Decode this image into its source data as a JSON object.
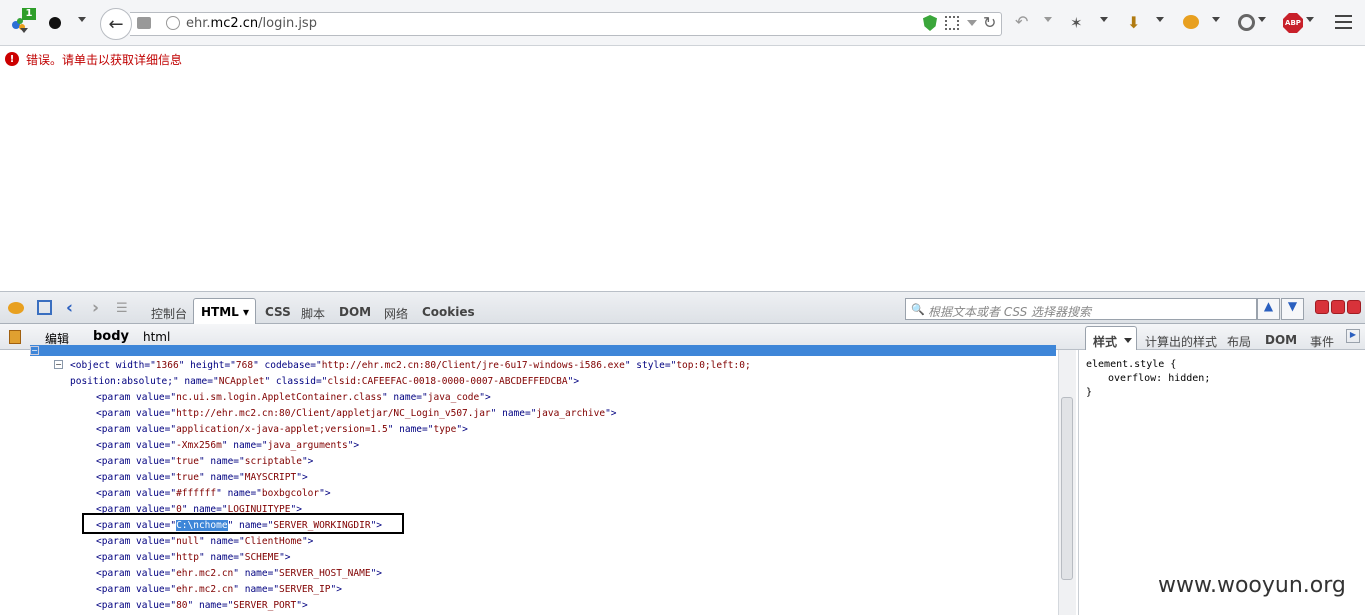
{
  "browser": {
    "url_prefix": "ehr.",
    "url_domain": "mc2.cn",
    "url_path": "/login.jsp",
    "badge_count": "1",
    "abp_label": "ABP"
  },
  "page": {
    "error_message": "错误。请单击以获取详细信息"
  },
  "firebug": {
    "tabs": [
      "控制台",
      "HTML",
      "CSS",
      "脚本",
      "DOM",
      "网络",
      "Cookies"
    ],
    "search_placeholder": "根据文本或者 CSS 选择器搜索",
    "edit_label": "编辑",
    "breadcrumb": [
      "body",
      "html"
    ],
    "side_tabs": [
      "样式",
      "计算出的样式",
      "布局",
      "DOM",
      "事件"
    ],
    "css_rule": {
      "selector": "element.style {",
      "prop": "overflow: hidden;",
      "close": "}"
    },
    "code_lines": [
      {
        "pre": "<object width=\"",
        "v1": "1366",
        "m1": "\" height=\"",
        "v2": "768",
        "m2": "\" codebase=\"",
        "v3": "http://ehr.mc2.cn:80/Client/jre-6u17-windows-i586.exe",
        "m3": "\" style=\"",
        "v4": "top:0;left:0;"
      },
      {
        "pre": "position:absolute;",
        "m1": "\" name=\"",
        "v2": "NCApplet",
        "m2": "\" classid=\"",
        "v3": "clsid:CAFEEFAC-0018-0000-0007-ABCDEFFEDCBA",
        "m3": "\">"
      },
      {
        "pre": "<param value=\"",
        "v1": "nc.ui.sm.login.AppletContainer.class",
        "m1": "\" name=\"",
        "v2": "java_code",
        "m2": "\">"
      },
      {
        "pre": "<param value=\"",
        "v1": "http://ehr.mc2.cn:80/Client/appletjar/NC_Login_v507.jar",
        "m1": "\" name=\"",
        "v2": "java_archive",
        "m2": "\">"
      },
      {
        "pre": "<param value=\"",
        "v1": "application/x-java-applet;version=1.5",
        "m1": "\" name=\"",
        "v2": "type",
        "m2": "\">"
      },
      {
        "pre": "<param value=\"",
        "v1": "-Xmx256m",
        "m1": "\" name=\"",
        "v2": "java_arguments",
        "m2": "\">"
      },
      {
        "pre": "<param value=\"",
        "v1": "true",
        "m1": "\" name=\"",
        "v2": "scriptable",
        "m2": "\">"
      },
      {
        "pre": "<param value=\"",
        "v1": "true",
        "m1": "\" name=\"",
        "v2": "MAYSCRIPT",
        "m2": "\">"
      },
      {
        "pre": "<param value=\"",
        "v1": "#ffffff",
        "m1": "\" name=\"",
        "v2": "boxbgcolor",
        "m2": "\">"
      },
      {
        "pre": "<param value=\"",
        "v1": "0",
        "m1": "\" name=\"",
        "v2": "LOGINUITYPE",
        "m2": "\">"
      },
      {
        "pre": "<param value=\"",
        "v1": "C:\\nchome",
        "m1": "\" name=\"",
        "v2": "SERVER_WORKINGDIR",
        "m2": "\">"
      },
      {
        "pre": "<param value=\"",
        "v1": "null",
        "m1": "\" name=\"",
        "v2": "ClientHome",
        "m2": "\">"
      },
      {
        "pre": "<param value=\"",
        "v1": "http",
        "m1": "\" name=\"",
        "v2": "SCHEME",
        "m2": "\">"
      },
      {
        "pre": "<param value=\"",
        "v1": "ehr.mc2.cn",
        "m1": "\" name=\"",
        "v2": "SERVER_HOST_NAME",
        "m2": "\">"
      },
      {
        "pre": "<param value=\"",
        "v1": "ehr.mc2.cn",
        "m1": "\" name=\"",
        "v2": "SERVER_IP",
        "m2": "\">"
      },
      {
        "pre": "<param value=\"",
        "v1": "80",
        "m1": "\" name=\"",
        "v2": "SERVER_PORT",
        "m2": "\">"
      }
    ]
  },
  "watermark": "www.wooyun.org"
}
